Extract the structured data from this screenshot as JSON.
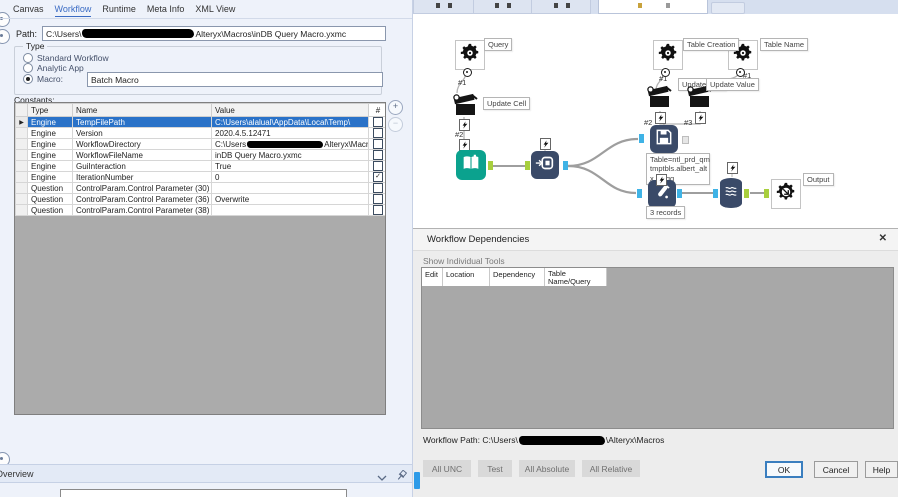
{
  "colors": {
    "selection": "#2a72c8",
    "teal": "#0ba28e",
    "navy": "#3a4a68",
    "connector_green": "#a8cf3d",
    "connector_blue": "#3fb3e6",
    "tab_accent": "#3a6bc4"
  },
  "icons": {
    "row_selector": "▶",
    "check": "✓",
    "add": "+",
    "remove": "−",
    "close": "✕"
  },
  "left": {
    "tabs": [
      {
        "label": "Canvas",
        "active": false
      },
      {
        "label": "Workflow",
        "active": true
      },
      {
        "label": "Runtime",
        "active": false
      },
      {
        "label": "Meta Info",
        "active": false
      },
      {
        "label": "XML View",
        "active": false
      }
    ],
    "path": {
      "label": "Path:",
      "value_prefix": "C:\\Users\\",
      "value_suffix": "Alteryx\\Macros\\inDB Query Macro.yxmc"
    },
    "type_group": {
      "title": "Type",
      "options": [
        {
          "label": "Standard Workflow",
          "selected": false
        },
        {
          "label": "Analytic App",
          "selected": false
        },
        {
          "label": "Macro:",
          "selected": true
        }
      ],
      "macro_value": "Batch Macro"
    },
    "constants": {
      "label": "Constants:",
      "columns": {
        "type": "Type",
        "name": "Name",
        "value": "Value",
        "hash": "#"
      },
      "rows": [
        {
          "type": "Engine",
          "name": "TempFilePath",
          "value": "C:\\Users\\alalual\\AppData\\Local\\Temp\\",
          "checked": false,
          "selected": true
        },
        {
          "type": "Engine",
          "name": "Version",
          "value": "2020.4.5.12471",
          "checked": false,
          "selected": false
        },
        {
          "type": "Engine",
          "name": "WorkflowDirectory",
          "value_prefix": "C:\\Users",
          "value_suffix": "Alteryx\\Macros",
          "redacted": true,
          "checked": false,
          "selected": false
        },
        {
          "type": "Engine",
          "name": "WorkflowFileName",
          "value": "inDB Query Macro.yxmc",
          "checked": false,
          "selected": false
        },
        {
          "type": "Engine",
          "name": "GuiInteraction",
          "value": "True",
          "checked": false,
          "selected": false
        },
        {
          "type": "Engine",
          "name": "IterationNumber",
          "value": "0",
          "checked": true,
          "selected": false
        },
        {
          "type": "Question",
          "name": "ControlParam.Control Parameter (30)",
          "value": "",
          "checked": false,
          "selected": false
        },
        {
          "type": "Question",
          "name": "ControlParam.Control Parameter (36)",
          "value": "Overwrite",
          "checked": false,
          "selected": false
        },
        {
          "type": "Question",
          "name": "ControlParam.Control Parameter (38)",
          "value": "",
          "checked": false,
          "selected": false
        }
      ]
    },
    "overview": {
      "title": "Overview"
    }
  },
  "canvas": {
    "tools": [
      {
        "id": "query-gear",
        "annotation": "Query"
      },
      {
        "id": "update-cell-action",
        "annotation": "Update Cell"
      },
      {
        "id": "macro-input"
      },
      {
        "id": "data-stream-in"
      },
      {
        "id": "table-creation-gear",
        "annotation": "Table Creation"
      },
      {
        "id": "table-name-gear",
        "annotation": "Table Name"
      },
      {
        "id": "update-value-action-1",
        "annotation": "Update Value"
      },
      {
        "id": "update-value-action-2",
        "annotation": "Update Value"
      },
      {
        "id": "write-in-db",
        "annotation": "Table=ntl_prd_qm\ntmptbls.albert_alt\nx_tstqq"
      },
      {
        "id": "sample-in-db",
        "annotation": "3 records"
      },
      {
        "id": "data-stream-out"
      },
      {
        "id": "macro-output",
        "annotation": "Output"
      }
    ],
    "connection_labels": {
      "query": "#1",
      "update_cell": "#2",
      "table_creation": "#1",
      "table_name": "#1",
      "action_a": "#2",
      "action_b": "#3"
    }
  },
  "deps": {
    "title": "Workflow Dependencies",
    "show_individual_tools": "Show Individual Tools",
    "columns": [
      "Edit",
      "Location",
      "Dependency",
      "Table Name/Query"
    ],
    "workflow_path": {
      "label": "Workflow Path:",
      "value_prefix": "C:\\Users\\",
      "value_suffix": "\\Alteryx\\Macros"
    },
    "left_buttons": [
      "All UNC",
      "Test",
      "All Absolute",
      "All Relative"
    ],
    "dialog_buttons": [
      "OK",
      "Cancel",
      "Help"
    ]
  }
}
